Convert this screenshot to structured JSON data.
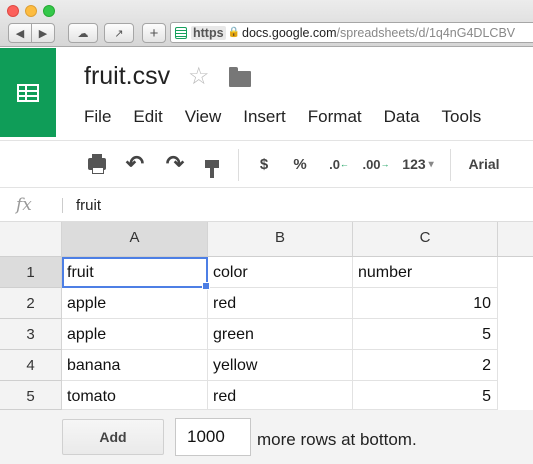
{
  "browser": {
    "url_scheme": "https",
    "url_host": "docs.google.com",
    "url_path": "/spreadsheets/d/1q4nG4DLCBV",
    "newtab_icon": "+"
  },
  "doc": {
    "title": "fruit.csv",
    "brand_color": "#0f9d58",
    "menu": [
      "File",
      "Edit",
      "View",
      "Insert",
      "Format",
      "Data",
      "Tools"
    ]
  },
  "toolbar": {
    "currency": "$",
    "percent": "%",
    "decrease_decimals": ".0",
    "increase_decimals": ".00",
    "number_format": "123",
    "dropdown_arrow": "▾",
    "font": "Arial"
  },
  "formula_bar": {
    "fx_label": "fx",
    "value": "fruit"
  },
  "grid": {
    "columns": [
      "A",
      "B",
      "C"
    ],
    "rows": [
      {
        "num": "1",
        "cells": [
          "fruit",
          "color",
          "number"
        ]
      },
      {
        "num": "2",
        "cells": [
          "apple",
          "red",
          "10"
        ]
      },
      {
        "num": "3",
        "cells": [
          "apple",
          "green",
          "5"
        ]
      },
      {
        "num": "4",
        "cells": [
          "banana",
          "yellow",
          "2"
        ]
      },
      {
        "num": "5",
        "cells": [
          "tomato",
          "red",
          "5"
        ]
      }
    ],
    "selected_cell": "A1",
    "selection_color": "#4d7fe5"
  },
  "footer": {
    "add_label": "Add",
    "rows_value": "1000",
    "suffix": "more rows at bottom."
  }
}
